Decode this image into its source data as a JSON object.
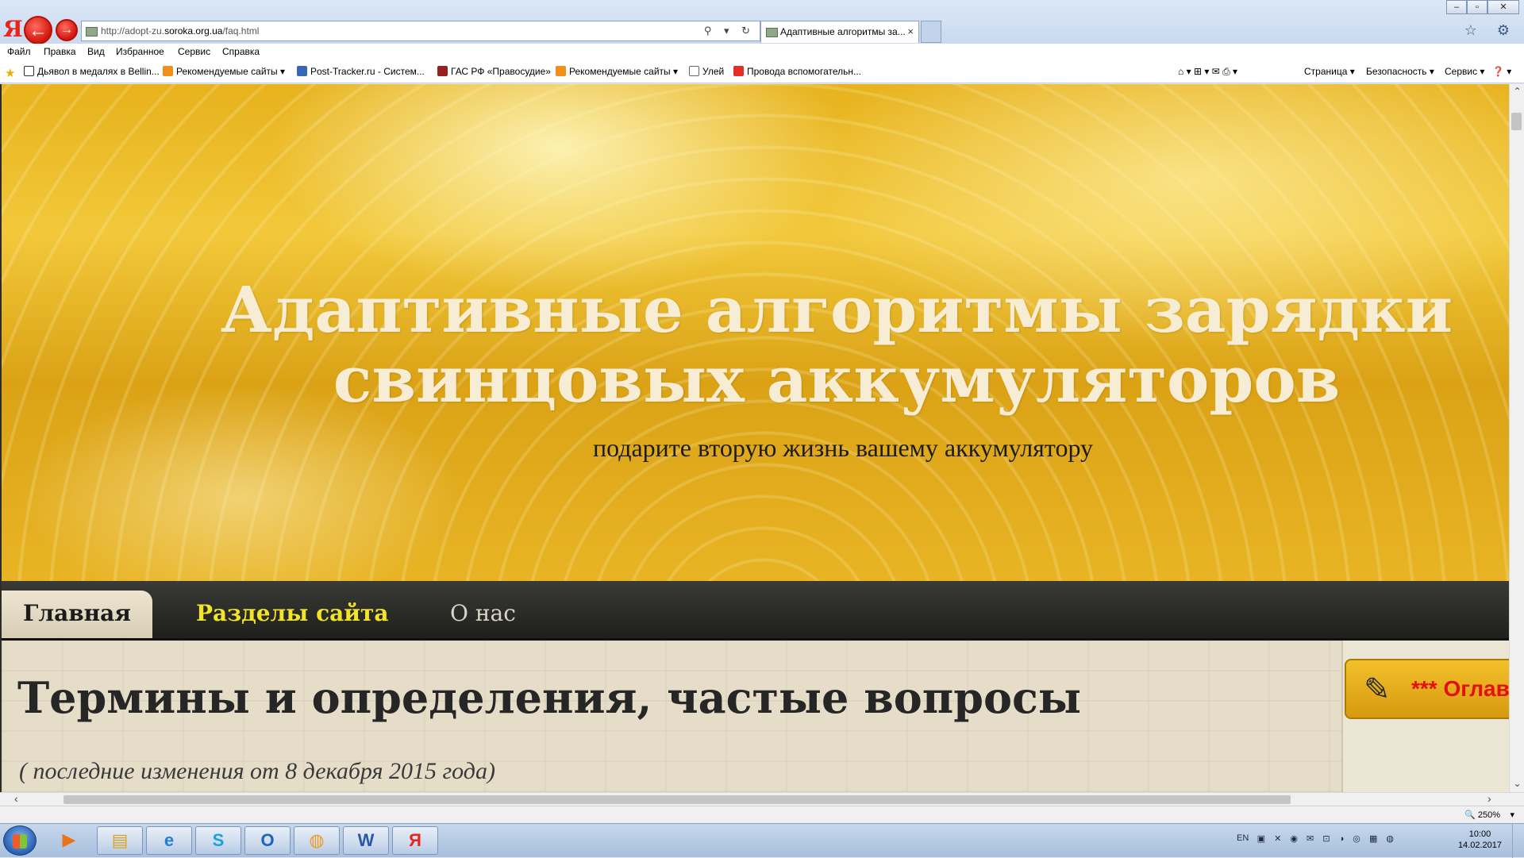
{
  "browser": {
    "logo_letter": "Я",
    "back_glyph": "←",
    "forward_glyph": "→",
    "address_prefix": "http://adopt-zu.",
    "address_domain": "soroka.org.ua",
    "address_suffix": "/faq.html",
    "address_tools": "⚲ ▾ ↻",
    "tab_title": "Адаптивные алгоритмы за...",
    "tab_close": "×",
    "window_controls": {
      "minimize": "–",
      "maximize": "▫",
      "close": "✕"
    },
    "right_icons": "☆ ⚙"
  },
  "menu": [
    "Файл",
    "Правка",
    "Вид",
    "Избранное",
    "Сервис",
    "Справка"
  ],
  "favorites": [
    {
      "label": "Дьявол в медалях в Bellin...",
      "icon": "page-icon"
    },
    {
      "label": "Рекомендуемые сайты ▾",
      "icon": "rss-icon"
    },
    {
      "label": "Post-Tracker.ru - Систем...",
      "icon": "post-tracker-icon"
    },
    {
      "label": "ГАС РФ «Правосудие»",
      "icon": "gas-icon"
    },
    {
      "label": "Рекомендуемые сайты ▾",
      "icon": "rss-icon"
    },
    {
      "label": "Улей",
      "icon": "hive-icon"
    },
    {
      "label": "Провода вспомогательн...",
      "icon": "youtube-icon"
    }
  ],
  "command_bar": {
    "icons": "⌂ ▾  ⊞ ▾  ✉  ⎙ ▾",
    "page": "Страница ▾",
    "security": "Безопасность ▾",
    "service": "Сервис ▾",
    "help": "❓ ▾"
  },
  "site": {
    "title": "Адаптивные алгоритмы зарядки свинцовых аккумуляторов",
    "subtitle": "подарите вторую жизнь вашему аккумулятору",
    "nav": {
      "home": "Главная",
      "sections": "Разделы сайта",
      "about": "О нас"
    },
    "page_title": "Термины и определения, частые вопросы",
    "page_note": "( последние изменения от 8 декабря 2015 года)",
    "toc_button": "*** Оглавление",
    "toc_icon": "✎"
  },
  "scroll": {
    "up": "⌃",
    "down": "⌄",
    "left": "‹",
    "right": "›"
  },
  "status": {
    "zoom": "🔍 250%",
    "zoom_arrow": "▾"
  },
  "taskbar": {
    "apps": [
      {
        "name": "media-player",
        "glyph": "▶",
        "color": "#e8741a"
      },
      {
        "name": "file-explorer",
        "glyph": "▤",
        "color": "#d9a520"
      },
      {
        "name": "internet-explorer",
        "glyph": "e",
        "color": "#1f7fd6"
      },
      {
        "name": "skype",
        "glyph": "S",
        "color": "#1aa0e0"
      },
      {
        "name": "outlook",
        "glyph": "O",
        "color": "#1866c0"
      },
      {
        "name": "app-orange",
        "glyph": "◍",
        "color": "#f09a18"
      },
      {
        "name": "word",
        "glyph": "W",
        "color": "#2a56a8"
      },
      {
        "name": "yandex-browser",
        "glyph": "Я",
        "color": "#e8241c"
      }
    ],
    "lang": "EN",
    "tray_icons": "▣ ✕ ◉ ✉ ⊡ ◑ ◎ ▦ ◍",
    "time": "10:00",
    "date": "14.02.2017"
  }
}
